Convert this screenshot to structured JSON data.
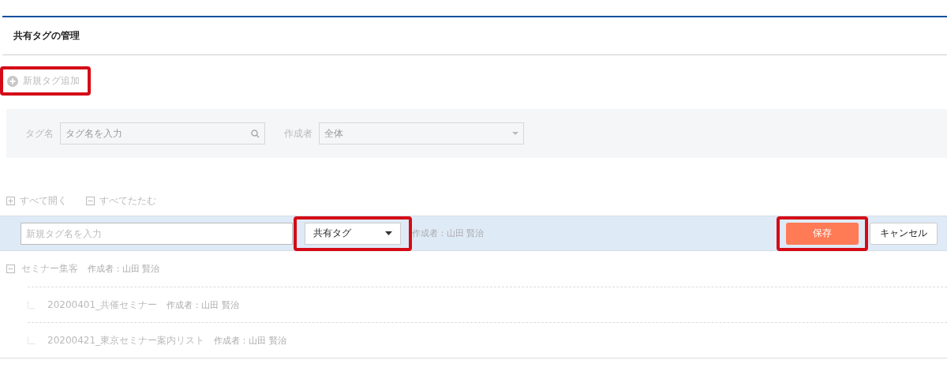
{
  "page": {
    "title": "共有タグの管理"
  },
  "add_tag": {
    "label": "新規タグ追加",
    "highlighted": true
  },
  "filter": {
    "tag_label": "タグ名",
    "tag_placeholder": "タグ名を入力",
    "author_label": "作成者",
    "author_value": "全体"
  },
  "tree_controls": [
    {
      "kind": "expand",
      "label": "すべて開く"
    },
    {
      "kind": "collapse",
      "label": "すべてたたむ"
    }
  ],
  "edit_row": {
    "name_placeholder": "新規タグ名を入力",
    "type_value": "共有タグ",
    "type_highlighted": true,
    "author": "作成者：山田 賢治",
    "save": "保存",
    "save_highlighted": true,
    "cancel": "キャンセル"
  },
  "tree": [
    {
      "name": "セミナー集客",
      "author": "作成者：山田 賢治",
      "expanded": true,
      "children": [
        {
          "name": "20200401_共催セミナー",
          "author": "作成者：山田 賢治"
        },
        {
          "name": "20200421_東京セミナー案内リスト",
          "author": "作成者：山田 賢治"
        }
      ]
    }
  ]
}
